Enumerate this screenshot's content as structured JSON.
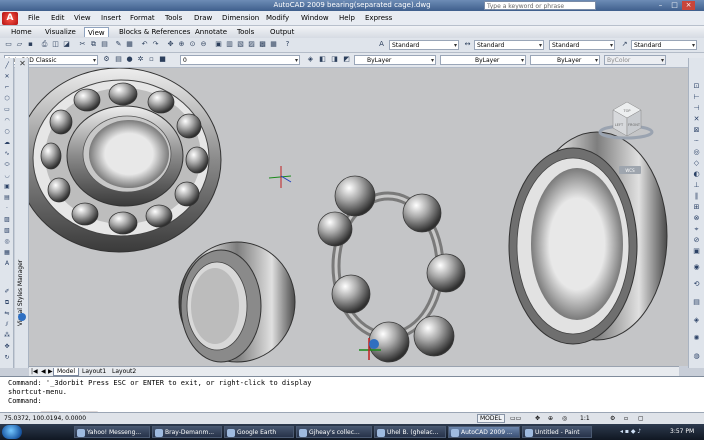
{
  "window": {
    "title": "AutoCAD 2009 bearing(separated cage).dwg",
    "search_placeholder": "Type a keyword or phrase",
    "controls": {
      "minimize": "–",
      "maximize": "□",
      "close": "×"
    }
  },
  "menubar": {
    "app_button": "A",
    "items": [
      "File",
      "Edit",
      "View",
      "Insert",
      "Format",
      "Tools",
      "Draw",
      "Dimension",
      "Modify",
      "Window",
      "Help",
      "Express"
    ]
  },
  "ribbon_tabs": [
    "Home",
    "Visualize",
    "View",
    "Blocks & References",
    "Annotate",
    "Tools",
    "Output"
  ],
  "ribbon_active_tab": "View",
  "toolbar": {
    "text_style": "Standard",
    "dim_style": "Standard",
    "table_style": "Standard",
    "multileader_style": "Standard",
    "workspace": "AutoCAD Classic",
    "layer": "0",
    "color": "ByLayer",
    "linetype": "ByLayer",
    "lineweight": "ByLayer",
    "plot_style": "ByColor"
  },
  "palette": {
    "label": "Visual Styles Manager",
    "close": "✕"
  },
  "viewcube": {
    "top": "TOP",
    "left": "LEFT",
    "front": "FRONT",
    "label": "WCS"
  },
  "layout_tabs": [
    "Model",
    "Layout1",
    "Layout2"
  ],
  "layout_active": "Model",
  "command": {
    "line1": "Command: '_3dorbit Press ESC or ENTER to exit, or right-click to display",
    "line2": "shortcut-menu.",
    "line3": "Command:"
  },
  "status": {
    "coords": "75.0372, 100.0194, 0.0000",
    "model": "MODEL",
    "scale": "1:1"
  },
  "taskbar": {
    "items": [
      "Yahoo! Messeng...",
      "Bray-Demanm...",
      "Google Earth",
      "Gjheay's collec...",
      "Uhel B. (ghelac...",
      "AutoCAD 2009 ...",
      "Untitled - Paint"
    ],
    "active": "AutoCAD 2009 ...",
    "clock": "3:57 PM"
  },
  "watermark": "西 网"
}
